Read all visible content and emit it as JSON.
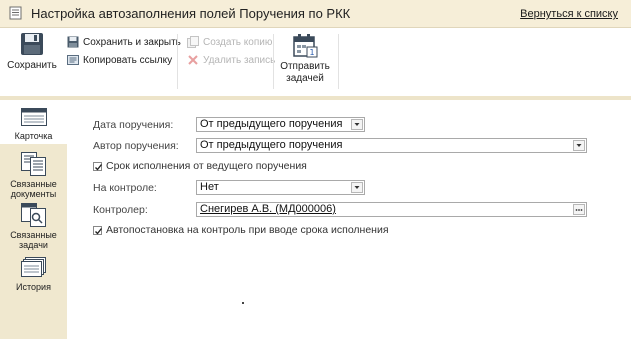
{
  "window": {
    "title": "Настройка автозаполнения полей Поручения по РКК",
    "back_link": "Вернуться к списку"
  },
  "toolbar": {
    "save": "Сохранить",
    "save_and_close": "Сохранить и закрыть",
    "copy_link": "Копировать ссылку",
    "create_copy": "Создать копию",
    "delete_record": "Удалить запись",
    "send_tasks_line1": "Отправить",
    "send_tasks_line2": "задачей"
  },
  "sidebar": {
    "items": [
      {
        "label": "Карточка",
        "active": true
      },
      {
        "label_line1": "Связанные",
        "label_line2": "документы"
      },
      {
        "label_line1": "Связанные",
        "label_line2": "задачи"
      },
      {
        "label": "История"
      }
    ]
  },
  "form": {
    "date_label": "Дата поручения:",
    "date_value": "От предыдущего поручения",
    "author_label": "Автор поручения:",
    "author_value": "От предыдущего поручения",
    "deadline_checkbox_label": "Срок исполнения от ведущего поручения",
    "deadline_checked": true,
    "control_label": "На контроле:",
    "control_value": "Нет",
    "controller_label": "Контролер:",
    "controller_value": "Снегирев А.В. (МД000006)",
    "auto_control_label": "Автопостановка на контроль при вводе срока исполнения",
    "auto_control_checked": true
  }
}
